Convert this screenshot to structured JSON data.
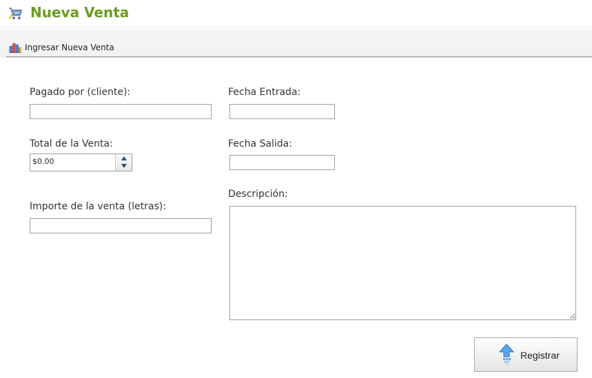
{
  "header": {
    "title": "Nueva Venta",
    "icon": "shopping-cart-icon",
    "title_color": "#6a9a1f"
  },
  "toolbar": {
    "items": [
      {
        "label": "Ingresar Nueva Venta",
        "icon": "bar-chart-icon"
      }
    ]
  },
  "form": {
    "pagado_por": {
      "label": "Pagado por (cliente):",
      "value": ""
    },
    "total_venta": {
      "label": "Total de la Venta:",
      "value": "$0.00"
    },
    "importe_letras": {
      "label": "Importe de la venta (letras):",
      "value": ""
    },
    "fecha_entrada": {
      "label": "Fecha Entrada:",
      "value": ""
    },
    "fecha_salida": {
      "label": "Fecha Salida:",
      "value": ""
    },
    "descripcion": {
      "label": "Descripción:",
      "value": ""
    }
  },
  "actions": {
    "registrar": {
      "label": "Registrar",
      "icon": "upload-arrow-icon"
    }
  }
}
